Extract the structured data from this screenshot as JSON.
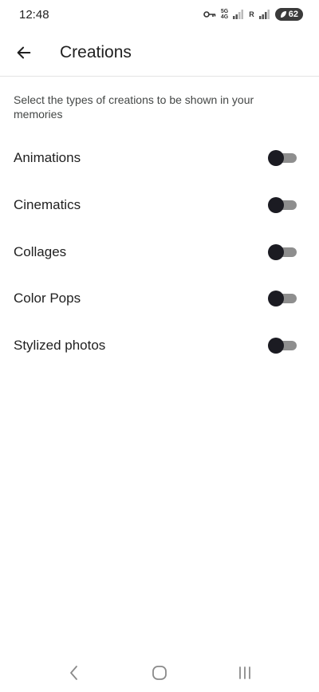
{
  "status_bar": {
    "time": "12:48",
    "network_top": "5G",
    "network_bottom": "4G",
    "signal_label": "R",
    "battery_level": "62",
    "icons": [
      "key-icon",
      "signal-icon",
      "battery-saver-icon"
    ]
  },
  "app_bar": {
    "title": "Creations",
    "back_icon": "arrow-left-icon"
  },
  "description": "Select the types of creations to be shown in your memories",
  "settings": [
    {
      "label": "Animations",
      "enabled": false
    },
    {
      "label": "Cinematics",
      "enabled": false
    },
    {
      "label": "Collages",
      "enabled": false
    },
    {
      "label": "Color Pops",
      "enabled": false
    },
    {
      "label": "Stylized photos",
      "enabled": false
    }
  ],
  "nav_bar": {
    "icons": [
      "back-nav-icon",
      "home-nav-icon",
      "recents-nav-icon"
    ]
  },
  "colors": {
    "background": "#ffffff",
    "text_primary": "#1f1f1f",
    "text_secondary": "#444746",
    "switch_thumb": "#1b1b22",
    "switch_track": "#8e8e8e"
  }
}
